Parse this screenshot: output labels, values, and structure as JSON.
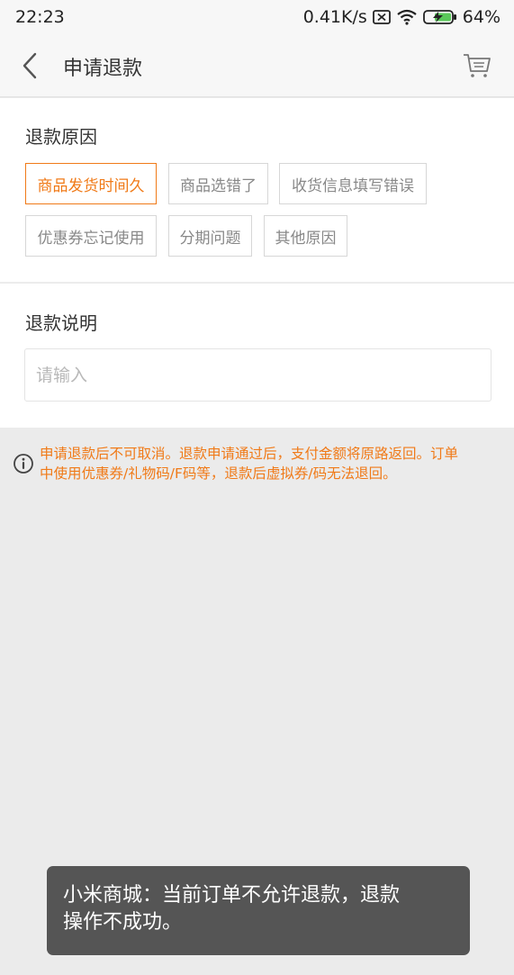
{
  "status_bar": {
    "time": "22:23",
    "network_speed": "0.41K/s",
    "battery": "64%",
    "icons": [
      "sim-off-icon",
      "wifi-icon",
      "battery-charging-icon"
    ]
  },
  "header": {
    "title": "申请退款",
    "back_icon": "chevron-left-icon",
    "cart_icon": "cart-icon"
  },
  "reason": {
    "title": "退款原因",
    "options": [
      {
        "label": "商品发货时间久",
        "selected": true
      },
      {
        "label": "商品选错了",
        "selected": false
      },
      {
        "label": "收货信息填写错误",
        "selected": false
      },
      {
        "label": "优惠券忘记使用",
        "selected": false
      },
      {
        "label": "分期问题",
        "selected": false
      },
      {
        "label": "其他原因",
        "selected": false
      }
    ]
  },
  "description": {
    "title": "退款说明",
    "placeholder": "请输入",
    "value": ""
  },
  "notice": {
    "icon": "info-icon",
    "line1": "申请退款后不可取消。退款申请通过后，支付金额将原路返回。订单",
    "line2": "中使用优惠券/礼物码/F码等，退款后虚拟券/码无法退回。"
  },
  "toast": {
    "line1": "小米商城：当前订单不允许退款，退款",
    "line2": "操作不成功。"
  },
  "colors": {
    "accent": "#f07a18",
    "background": "#ebebeb",
    "toast": "#555555"
  }
}
